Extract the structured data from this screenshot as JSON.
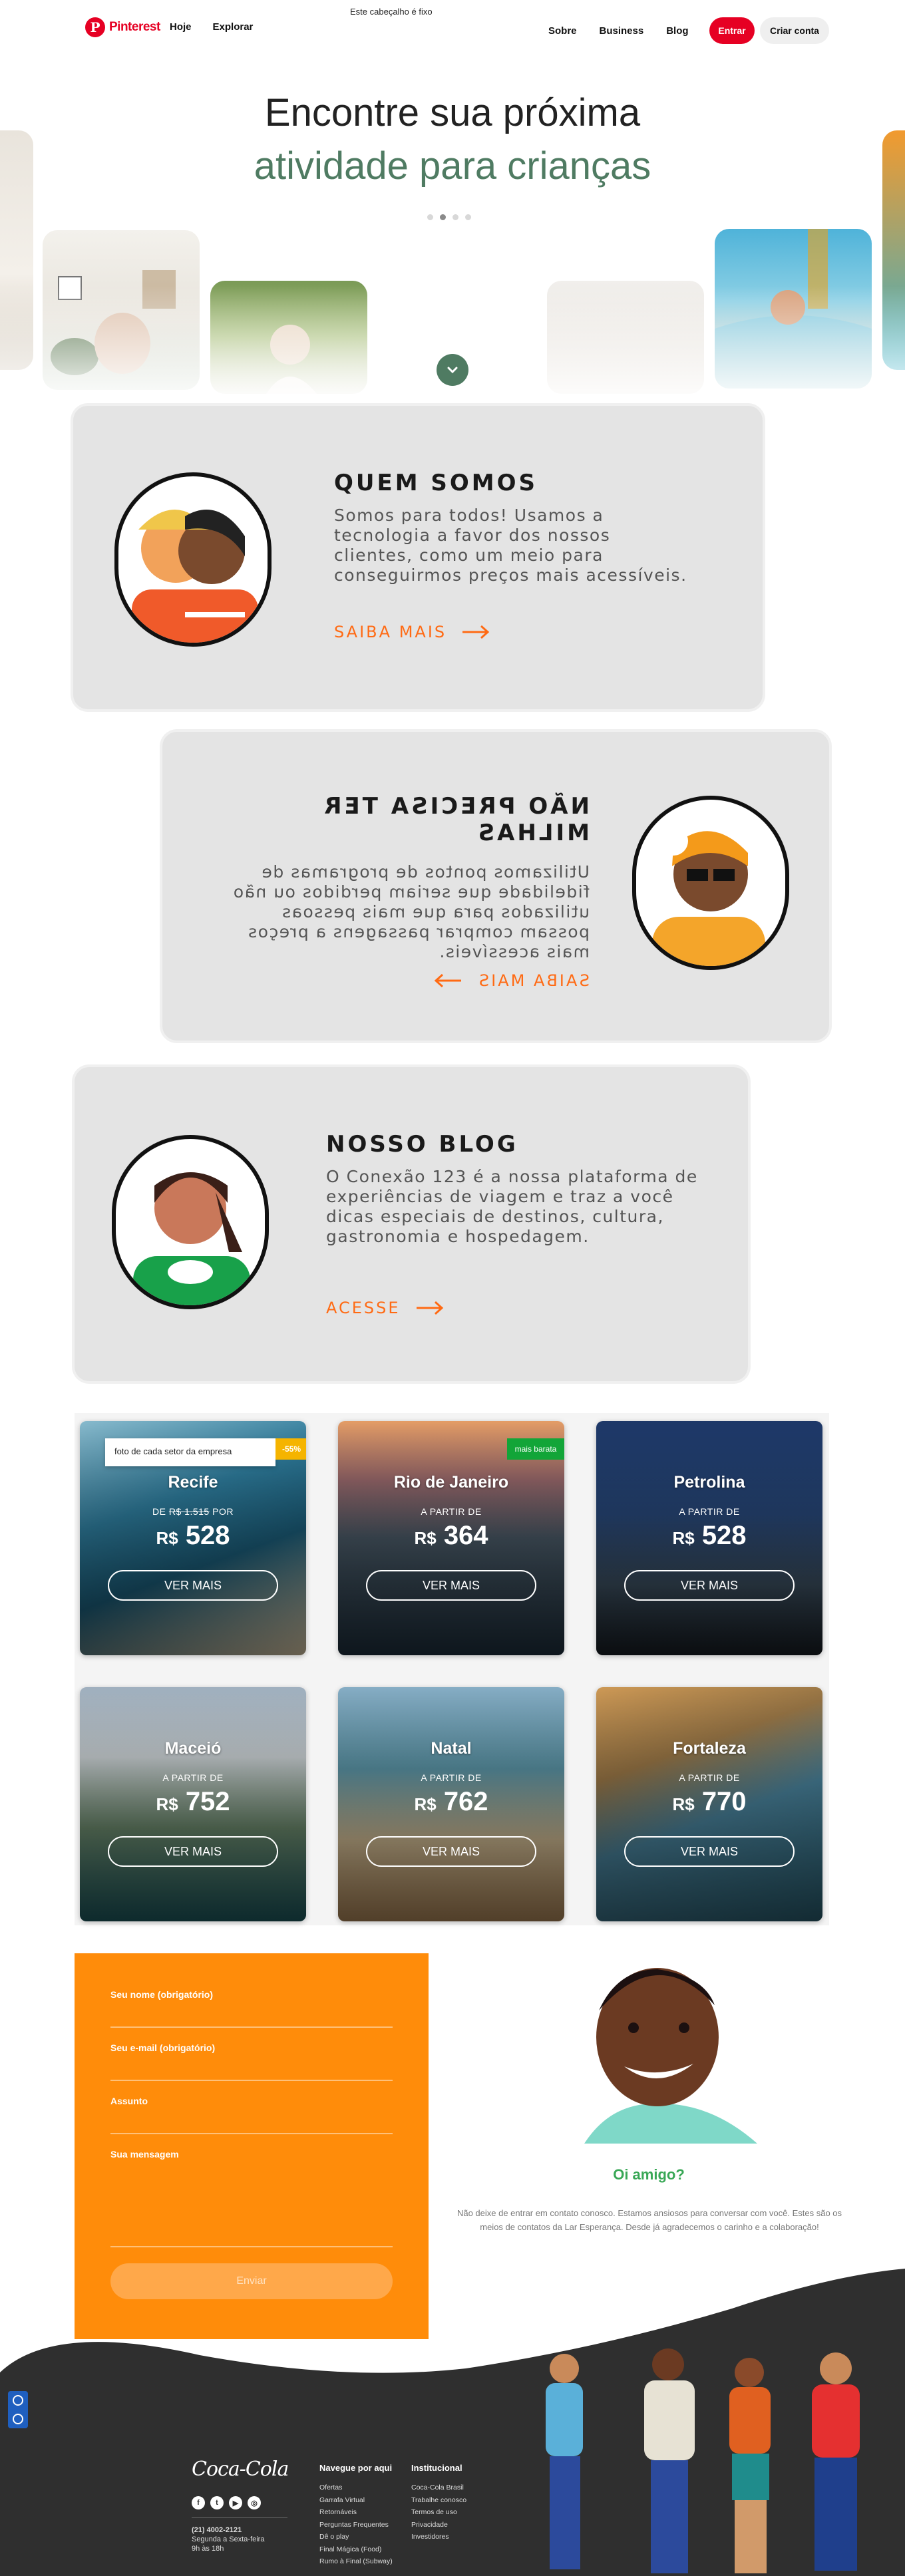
{
  "header": {
    "fixed_note": "Este cabeçalho é fixo",
    "brand": "Pinterest",
    "nav_left": [
      "Hoje",
      "Explorar"
    ],
    "nav_right": [
      "Sobre",
      "Business",
      "Blog"
    ],
    "login": "Entrar",
    "signup": "Criar conta"
  },
  "hero": {
    "line1": "Encontre sua próxima",
    "line2": "atividade para crianças",
    "dots_active": 1,
    "dots_total": 4
  },
  "quem": {
    "title": "QUEM SOMOS",
    "text": "Somos para todos! Usamos a tecnologia a favor dos nossos clientes, como um meio para conseguirmos preços mais acessíveis.",
    "link": "SAIBA MAIS"
  },
  "milhas": {
    "title": "NÃO PRECISA TER MILHAS",
    "text": "Utilizamos pontos de programas de fidelidade que seriam perdidos ou não utilizados para que mais pessoas possam comprar passagens a preços mais acessíveis.",
    "link": "SAIBA MAIS"
  },
  "blog": {
    "title": "NOSSO BLOG",
    "text": "O Conexão 123 é a nossa plataforma de experiências de viagem e traz a você dicas especiais de destinos, cultura, gastronomia e hospedagem.",
    "link": "ACESSE"
  },
  "destinations": {
    "photo_badge": "foto de cada setor da empresa",
    "discount_badge": "-55%",
    "green_badge": "mais barata",
    "old_price_prefix": "DE",
    "old_price": "R$ 1.515",
    "old_price_suffix": "POR",
    "from_label": "A PARTIR DE",
    "currency": "R$",
    "button": "VER MAIS",
    "items": [
      {
        "city": "Recife",
        "price": "528"
      },
      {
        "city": "Rio de Janeiro",
        "price": "364"
      },
      {
        "city": "Petrolina",
        "price": "528"
      },
      {
        "city": "Maceió",
        "price": "752"
      },
      {
        "city": "Natal",
        "price": "762"
      },
      {
        "city": "Fortaleza",
        "price": "770"
      }
    ]
  },
  "contact": {
    "name_label": "Seu nome (obrigatório)",
    "email_label": "Seu e-mail (obrigatório)",
    "subject_label": "Assunto",
    "message_label": "Sua mensagem",
    "send": "Enviar",
    "greeting_title": "Oi amigo?",
    "greeting_text": "Não deixe de entrar em contato conosco. Estamos ansiosos para conversar com você. Estes são os meios de contatos da Lar Esperança. Desde já agradecemos o carinho e a colaboração!"
  },
  "footer": {
    "brand": "Coca-Cola",
    "phone": "(21) 4002-2121",
    "hours_1": "Segunda a Sexta-feira",
    "hours_2": "9h às 18h",
    "nav_title": "Navegue por aqui",
    "nav_items": [
      "Ofertas",
      "Garrafa Virtual",
      "Retornáveis",
      "Perguntas Frequentes",
      "Dê o play",
      "Final Mágica (Food)",
      "Rumo à Final (Subway)"
    ],
    "inst_title": "Institucional",
    "inst_items": [
      "Coca-Cola Brasil",
      "Trabalhe conosco",
      "Termos de uso",
      "Privacidade",
      "Investidores"
    ],
    "social_icons": [
      "facebook-icon",
      "twitter-icon",
      "youtube-icon",
      "instagram-icon"
    ]
  },
  "colors": {
    "pinterest_red": "#e60023",
    "hero_green": "#4f7b62",
    "accent_orange": "#ff6a13",
    "form_orange": "#ff8c0a",
    "footer_dark": "#2f2f2f",
    "greeting_green": "#3aa857"
  }
}
